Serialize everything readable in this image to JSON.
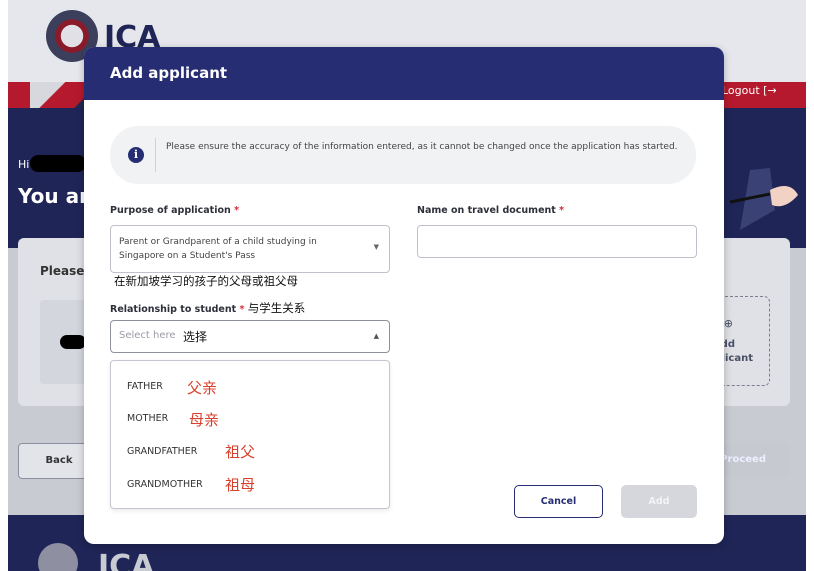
{
  "background": {
    "logo_text": "ICA",
    "logout_label": "Logout",
    "greeting": "Hi",
    "heading_partial": "You ar",
    "card_prompt": "Please",
    "add_applicant_l1": "dd",
    "add_applicant_l2": "licant",
    "back_label": "Back",
    "proceed_label": "Proceed",
    "footer_logo_text": "ICA"
  },
  "modal": {
    "title": "Add applicant",
    "notice": "Please ensure the accuracy of the information entered, as it cannot be changed once the application has started.",
    "purpose": {
      "label": "Purpose of application",
      "required_mark": "*",
      "value": "Parent or Grandparent of a child studying in Singapore on a Student's Pass",
      "annotation_cn": "在新加坡学习的孩子的父母或祖父母"
    },
    "name": {
      "label": "Name on travel document",
      "required_mark": "*",
      "value": ""
    },
    "relationship": {
      "label": "Relationship to student",
      "required_mark": "*",
      "label_cn": "与学生关系",
      "placeholder": "Select here",
      "placeholder_cn": "选择",
      "options": [
        {
          "label": "FATHER",
          "cn": "父亲"
        },
        {
          "label": "MOTHER",
          "cn": "母亲"
        },
        {
          "label": "GRANDFATHER",
          "cn": "祖父"
        },
        {
          "label": "GRANDMOTHER",
          "cn": "祖母"
        }
      ]
    },
    "cancel_label": "Cancel",
    "add_label": "Add"
  },
  "colors": {
    "modal_header": "#262d72",
    "required": "#d3293c",
    "annotation": "#d9402b",
    "add_disabled": "#d6d7dc"
  }
}
